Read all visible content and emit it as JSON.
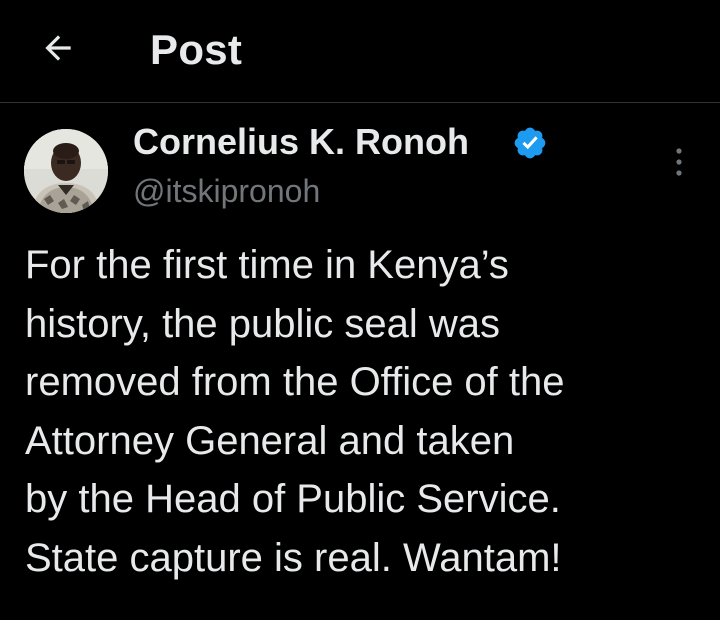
{
  "header": {
    "back_icon": "arrow-left-icon",
    "title": "Post"
  },
  "post": {
    "author": {
      "name": "Cornelius K. Ronoh",
      "handle": "@itskipronoh",
      "verified": true,
      "verified_icon": "verified-badge-icon",
      "avatar": "avatar-photo"
    },
    "more_icon": "more-vertical-icon",
    "text_lines": [
      "For the first time in Kenya’s",
      "history, the public seal was",
      "removed from the Office of the",
      "Attorney General and taken",
      "by the Head of Public Service.",
      "State capture is real. Wantam!"
    ]
  },
  "colors": {
    "background": "#000000",
    "primary_text": "#e7e9ea",
    "secondary_text": "#71767b",
    "divider": "#2f3336",
    "verified_badge": "#1d9bf0"
  }
}
